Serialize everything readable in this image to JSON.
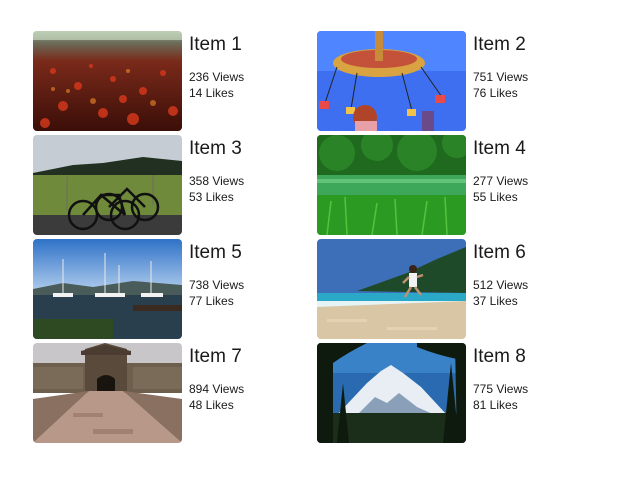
{
  "items": [
    {
      "title": "Item 1",
      "views": "236 Views",
      "likes": "14 Likes",
      "image": "red-leaves-path-photo"
    },
    {
      "title": "Item 2",
      "views": "751 Views",
      "likes": "76 Likes",
      "image": "swing-carousel-ride-photo"
    },
    {
      "title": "Item 3",
      "views": "358 Views",
      "likes": "53 Likes",
      "image": "bicycles-field-photo"
    },
    {
      "title": "Item 4",
      "views": "277 Views",
      "likes": "55 Likes",
      "image": "green-forest-pond-photo"
    },
    {
      "title": "Item 5",
      "views": "738 Views",
      "likes": "77 Likes",
      "image": "harbor-sailboats-photo"
    },
    {
      "title": "Item 6",
      "views": "512 Views",
      "likes": "37 Likes",
      "image": "beach-runner-photo"
    },
    {
      "title": "Item 7",
      "views": "894 Views",
      "likes": "48 Likes",
      "image": "old-fort-gate-photo"
    },
    {
      "title": "Item 8",
      "views": "775 Views",
      "likes": "81 Likes",
      "image": "snowy-mountain-trees-photo"
    }
  ]
}
